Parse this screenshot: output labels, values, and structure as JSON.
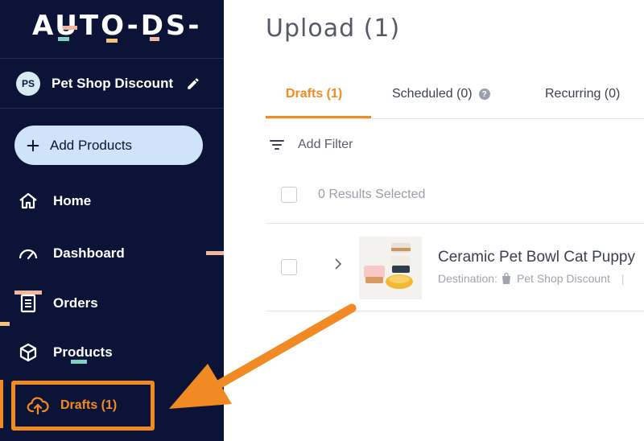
{
  "sidebar": {
    "logo": "AUTO-DS-",
    "store": {
      "avatar_initials": "PS",
      "name": "Pet Shop Discount"
    },
    "add_button": "Add Products",
    "nav": [
      {
        "label": "Home",
        "icon": "home-icon"
      },
      {
        "label": "Dashboard",
        "icon": "gauge-icon"
      },
      {
        "label": "Orders",
        "icon": "receipt-icon"
      },
      {
        "label": "Products",
        "icon": "box-icon"
      },
      {
        "label": "Drafts (1)",
        "icon": "cloud-upload-icon"
      }
    ]
  },
  "main": {
    "title": "Upload (1)",
    "tabs": [
      {
        "label": "Drafts (1)",
        "active": true
      },
      {
        "label": "Scheduled (0)",
        "active": false
      },
      {
        "label": "Recurring (0)",
        "active": false
      }
    ],
    "filter_label": "Add Filter",
    "results_label": "0 Results Selected",
    "product": {
      "title": "Ceramic Pet Bowl Cat Puppy",
      "destination_label": "Destination:",
      "destination_store": "Pet Shop Discount"
    }
  },
  "colors": {
    "sidebar_bg": "#0b1437",
    "accent": "#f28a23",
    "add_button_bg": "#cfe4f8"
  }
}
